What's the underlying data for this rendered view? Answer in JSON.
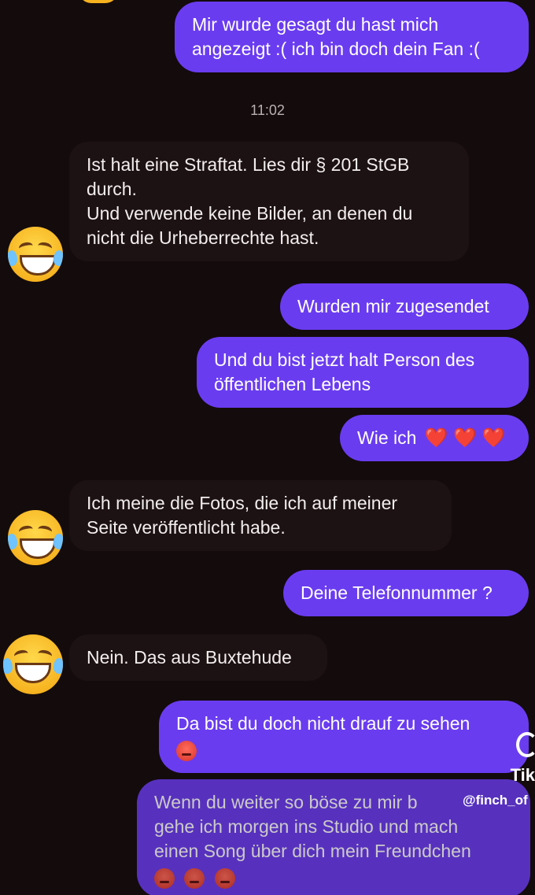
{
  "messages": [
    {
      "lines": [
        "Mir wurde gesagt du hast mich",
        "angezeigt :( ich bin doch dein Fan :("
      ]
    },
    {
      "time": "11:02"
    },
    {
      "lines": [
        "Ist halt eine Straftat. Lies dir § 201 StGB",
        "durch.",
        "Und verwende keine Bilder, an denen du",
        "nicht die Urheberrechte hast."
      ]
    },
    {
      "lines": [
        "Wurden mir zugesendet"
      ]
    },
    {
      "lines": [
        "Und du bist jetzt halt Person des",
        "öffentlichen Lebens"
      ]
    },
    {
      "lines": [
        "Wie ich"
      ]
    },
    {
      "lines": [
        "Ich meine die Fotos, die ich auf meiner",
        "Seite veröffentlicht habe."
      ]
    },
    {
      "lines": [
        "Deine Telefonnummer ?"
      ]
    },
    {
      "lines": [
        "Nein. Das aus Buxtehude"
      ]
    },
    {
      "lines": [
        "Da bist du doch nicht drauf zu sehen"
      ]
    },
    {
      "lines": [
        "Wenn du weiter so böse zu mir b",
        "gehe ich morgen ins Studio und mach",
        "einen Song über dich mein Freundchen"
      ]
    }
  ],
  "emoji": {
    "hearts": "❤️ ❤️ ❤️",
    "avatar": "face-with-tears-of-joy",
    "angry": "angry-face"
  },
  "watermark": {
    "brand": "Tik",
    "user": "@finch_of"
  },
  "colors": {
    "background": "#140b0c",
    "outgoing": "#6a3cf0",
    "incoming": "#1d1213"
  }
}
